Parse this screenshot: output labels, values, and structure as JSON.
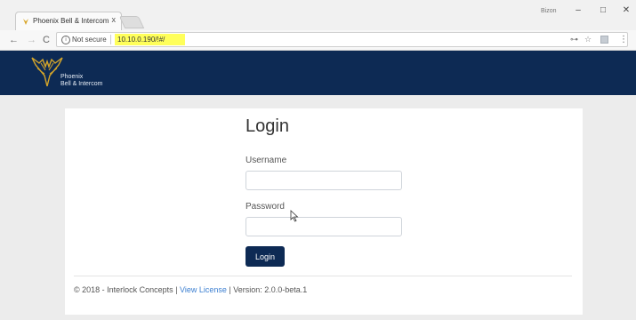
{
  "browser": {
    "tab_title": "Phoenix Bell & Intercom",
    "tab_close": "x",
    "profile_name": "Bizon",
    "window_controls": {
      "minimize": "–",
      "maximize": "□",
      "close": "✕"
    },
    "nav": {
      "back": "←",
      "forward": "→",
      "reload": "C"
    },
    "security_label": "Not secure",
    "url": "10.10.0.190/!#/",
    "toolbar_icons": [
      "key-icon",
      "star-icon",
      "extension-icon",
      "menu-icon"
    ],
    "url_highlight_color": "#ffff5a"
  },
  "site": {
    "brand_line1": "Phoenix",
    "brand_line2": "Bell & Intercom",
    "header_color": "#0d2a54"
  },
  "login": {
    "title": "Login",
    "username_label": "Username",
    "username_value": "",
    "password_label": "Password",
    "password_value": "",
    "submit_label": "Login"
  },
  "footer": {
    "copyright": "© 2018 - Interlock Concepts | ",
    "license_link": "View License",
    "version": " | Version: 2.0.0-beta.1",
    "link_color": "#3c7fd1"
  }
}
